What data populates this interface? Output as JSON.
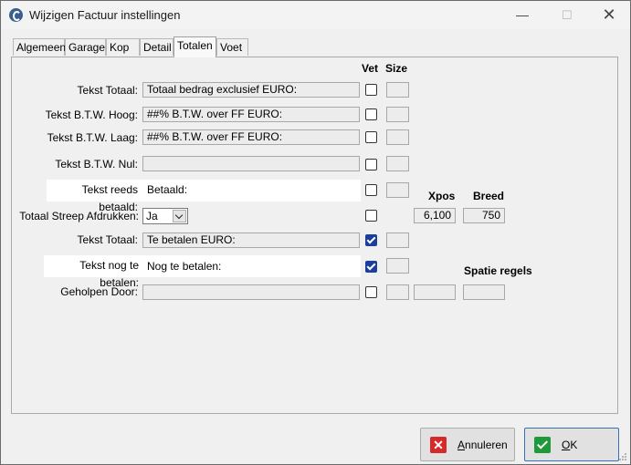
{
  "window": {
    "title": "Wijzigen Factuur instellingen",
    "minimize": "—",
    "maximize": "☐",
    "close": "✕"
  },
  "tabs": [
    {
      "label": "Algemeen"
    },
    {
      "label": "Garage"
    },
    {
      "label": "Kop"
    },
    {
      "label": "Detail"
    },
    {
      "label": "Totalen"
    },
    {
      "label": "Voet"
    }
  ],
  "active_tab": "Totalen",
  "headers": {
    "vet": "Vet",
    "size": "Size",
    "xpos": "Xpos",
    "breed": "Breed",
    "spatie": "Spatie regels"
  },
  "rows": [
    {
      "label": "Tekst Totaal:",
      "value": "Totaal bedrag exclusief EURO:",
      "vet": false
    },
    {
      "label": "Tekst B.T.W. Hoog:",
      "value": "##% B.T.W. over FF EURO:",
      "vet": false
    },
    {
      "label": "Tekst B.T.W. Laag:",
      "value": "##% B.T.W. over FF EURO:",
      "vet": false
    },
    {
      "label": "Tekst B.T.W. Nul:",
      "value": "",
      "vet": false
    },
    {
      "label": "Tekst reeds betaald:",
      "value": "Betaald:",
      "vet": false
    },
    {
      "label": "Totaal Streep Afdrukken:",
      "value": "Ja",
      "vet": false
    },
    {
      "label": "Tekst Totaal:",
      "value": "Te betalen EURO:",
      "vet": true
    },
    {
      "label": "Tekst nog te betalen:",
      "value": "Nog te betalen:",
      "vet": true
    },
    {
      "label": "Geholpen Door:",
      "value": "",
      "vet": false
    }
  ],
  "xpos_value": "6,100",
  "breed_value": "750",
  "buttons": {
    "cancel": "Annuleren",
    "cancel_mnemonic": "A",
    "cancel_rest": "nnuleren",
    "ok": "OK",
    "ok_mnemonic": "O",
    "ok_rest": "K"
  },
  "colors": {
    "checked": "#1b3f9c",
    "highlight": "#ffffff"
  }
}
